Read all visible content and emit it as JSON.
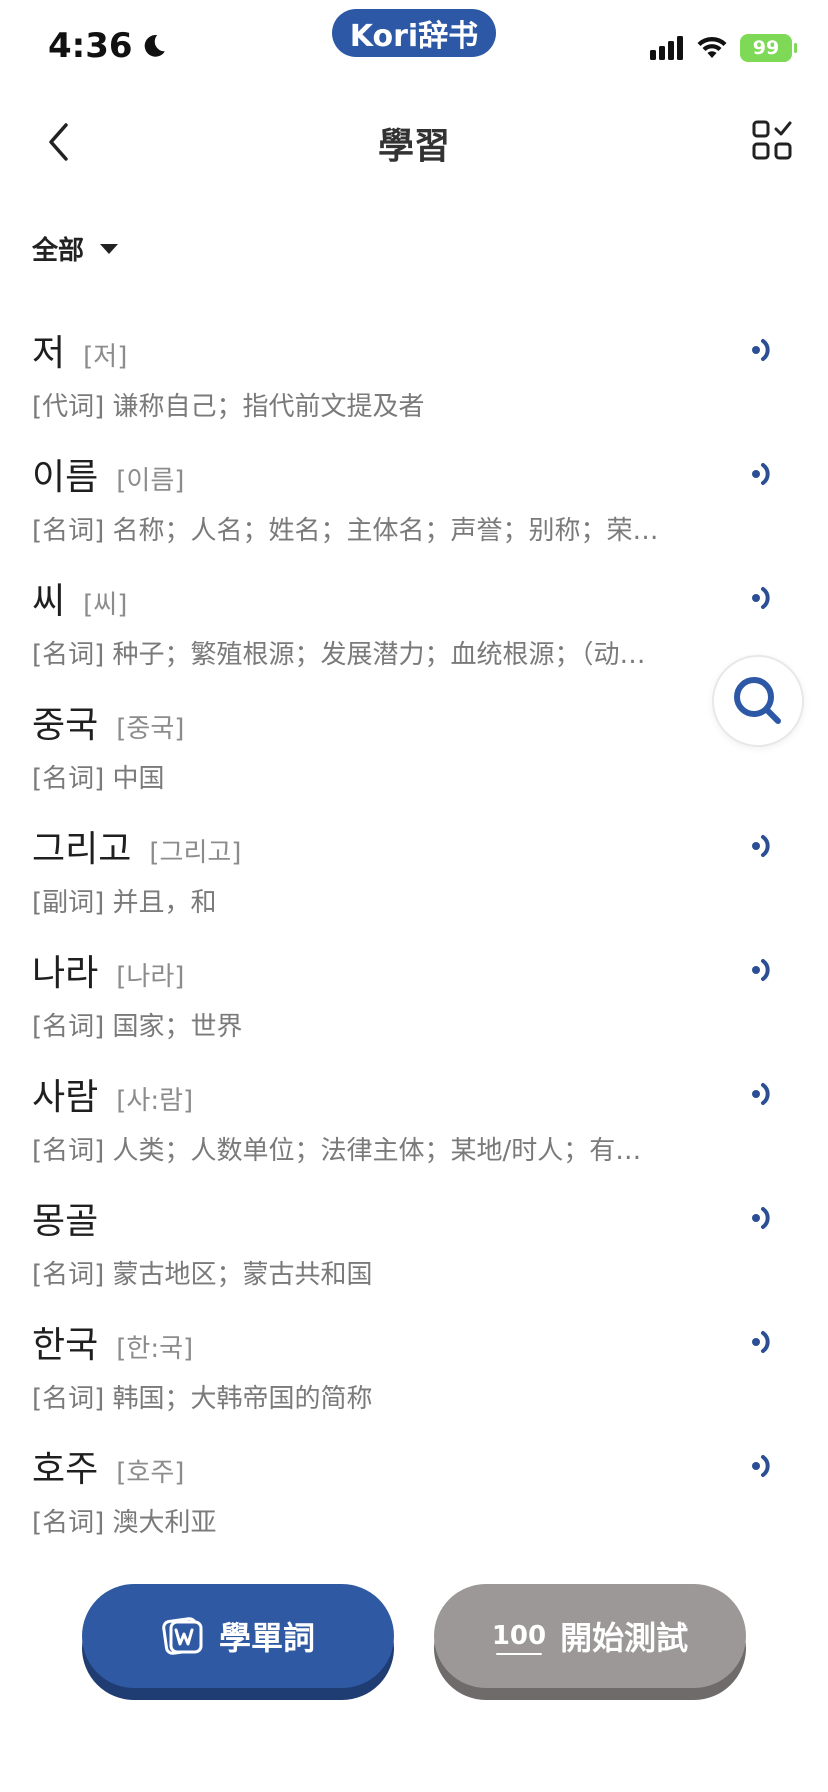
{
  "status_bar": {
    "time": "4:36",
    "app_badge": "Kori辞书",
    "battery": "99"
  },
  "header": {
    "title": "學習"
  },
  "filter": {
    "label": "全部"
  },
  "words": [
    {
      "head": "저",
      "pron": "[저]",
      "def": "[代词] 谦称自己；指代前文提及者",
      "has_audio": true
    },
    {
      "head": "이름",
      "pron": "[이름]",
      "def": "[名词] 名称；人名；姓名；主体名；声誉；别称；荣…",
      "has_audio": true
    },
    {
      "head": "씨",
      "pron": "[씨]",
      "def": "[名词] 种子；繁殖根源；发展潜力；血统根源；（动…",
      "has_audio": true
    },
    {
      "head": "중국",
      "pron": "[중국]",
      "def": "[名词] 中国",
      "has_audio": false
    },
    {
      "head": "그리고",
      "pron": "[그리고]",
      "def": "[副词] 并且，和",
      "has_audio": true
    },
    {
      "head": "나라",
      "pron": "[나라]",
      "def": "[名词] 国家；世界",
      "has_audio": true
    },
    {
      "head": "사람",
      "pron": "[사:람]",
      "def": "[名词] 人类；人数单位；法律主体；某地/时人；有…",
      "has_audio": true
    },
    {
      "head": "몽골",
      "pron": "",
      "def": "[名词] 蒙古地区；蒙古共和国",
      "has_audio": true
    },
    {
      "head": "한국",
      "pron": "[한:국]",
      "def": "[名词] 韩国；大韩帝国的简称",
      "has_audio": true
    },
    {
      "head": "호주",
      "pron": "[호주]",
      "def": "[名词] 澳大利亚",
      "has_audio": true
    }
  ],
  "buttons": {
    "learn_label": "學單詞",
    "test_label": "開始測試",
    "test_icon_text": "100"
  },
  "colors": {
    "accent": "#2f5aa3",
    "speaker": "#2c4f94",
    "battery": "#7ed957",
    "test_button": "#9c9898"
  },
  "icons": {
    "back": "chevron-left-icon",
    "grid": "grid-check-icon",
    "speaker": "speaker-icon",
    "search": "search-icon",
    "learn": "word-card-icon"
  }
}
